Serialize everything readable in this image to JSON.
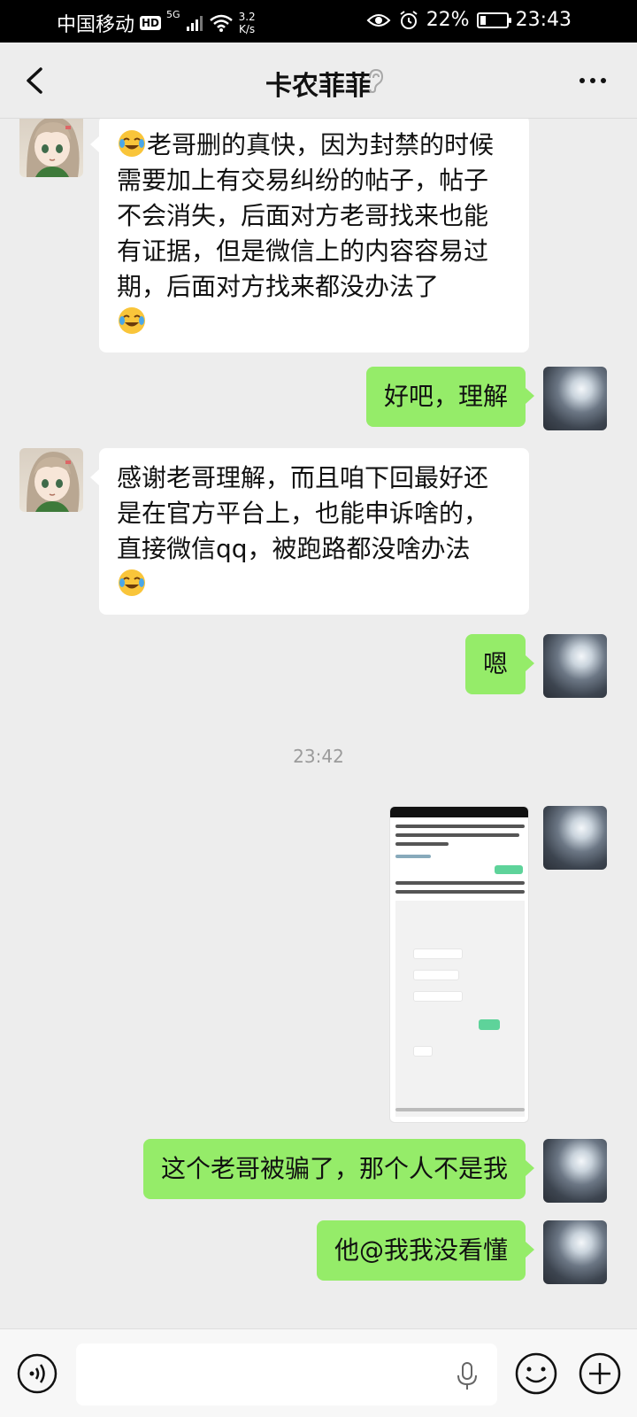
{
  "status_bar": {
    "carrier": "中国移动",
    "hd": "HD",
    "network": "5G",
    "speed_value": "3.2",
    "speed_unit": "K/s",
    "battery": "22%",
    "battery_level": 0.22,
    "time": "23:43"
  },
  "header": {
    "title": "卡农菲菲"
  },
  "messages": [
    {
      "side": "received",
      "text_before": "",
      "text": "老哥删的真快，因为封禁的时候需要加上有交易纠纷的帖子，帖子不会消失，后面对方老哥找来也能有证据，但是微信上的内容容易过期，后面对方找来都没办法了",
      "emoji_leading": "face-with-tears-of-joy",
      "emoji_trailing": "face-with-tears-of-joy"
    },
    {
      "side": "sent",
      "text": "好吧，理解"
    },
    {
      "side": "received",
      "text": "感谢老哥理解，而且咱下回最好还是在官方平台上，也能申诉啥的，直接微信qq，被跑路都没啥办法",
      "emoji_trailing": "face-with-tears-of-joy"
    },
    {
      "side": "sent",
      "text": "嗯"
    },
    {
      "side": "timestamp",
      "text": "23:42"
    },
    {
      "side": "sent",
      "type": "image"
    },
    {
      "side": "sent",
      "text": "这个老哥被骗了，那个人不是我"
    },
    {
      "side": "sent",
      "text": "他@我我没看懂"
    }
  ],
  "input": {
    "placeholder": ""
  },
  "colors": {
    "sent_bubble": "#95ec69",
    "received_bubble": "#ffffff",
    "background": "#ededed"
  }
}
